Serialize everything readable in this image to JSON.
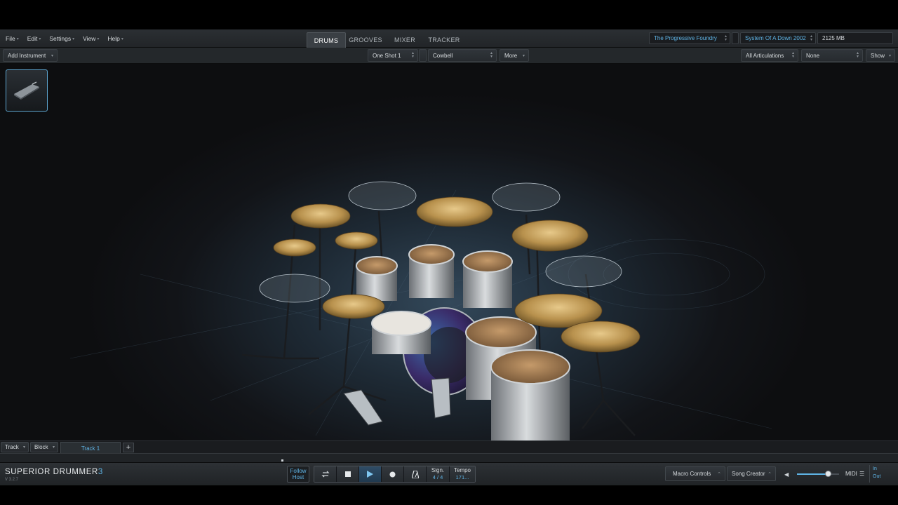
{
  "menu": [
    {
      "label": "File"
    },
    {
      "label": "Edit"
    },
    {
      "label": "Settings"
    },
    {
      "label": "View"
    },
    {
      "label": "Help"
    }
  ],
  "tabs": [
    {
      "label": "DRUMS",
      "active": true
    },
    {
      "label": "GROOVES"
    },
    {
      "label": "MIXER"
    },
    {
      "label": "TRACKER"
    }
  ],
  "header": {
    "library": "The Progressive Foundry",
    "preset": "System Of A Down 2002",
    "memory": "2125 MB"
  },
  "toolbar": {
    "add_instrument": "Add Instrument",
    "one_shot": "One Shot 1",
    "instrument": "Cowbell",
    "more": "More",
    "articulations": "All Articulations",
    "none": "None",
    "show": "Show"
  },
  "track": {
    "track_menu": "Track",
    "block_menu": "Block",
    "track_tab": "Track 1"
  },
  "transport": {
    "logo_main": "SUPERIOR DRUMMER",
    "logo_num": "3",
    "version": "V 3.2.7",
    "follow_line1": "Follow",
    "follow_line2": "Host",
    "sig_label": "Sign.",
    "sig_value": "4 / 4",
    "tempo_label": "Tempo",
    "tempo_value": "171...",
    "macro_controls": "Macro Controls",
    "song_creator": "Song Creator",
    "volume": 0.75,
    "midi": "MIDI",
    "in": "In",
    "out": "Out"
  },
  "colors": {
    "accent": "#5fb4e6",
    "background": "#141618"
  }
}
